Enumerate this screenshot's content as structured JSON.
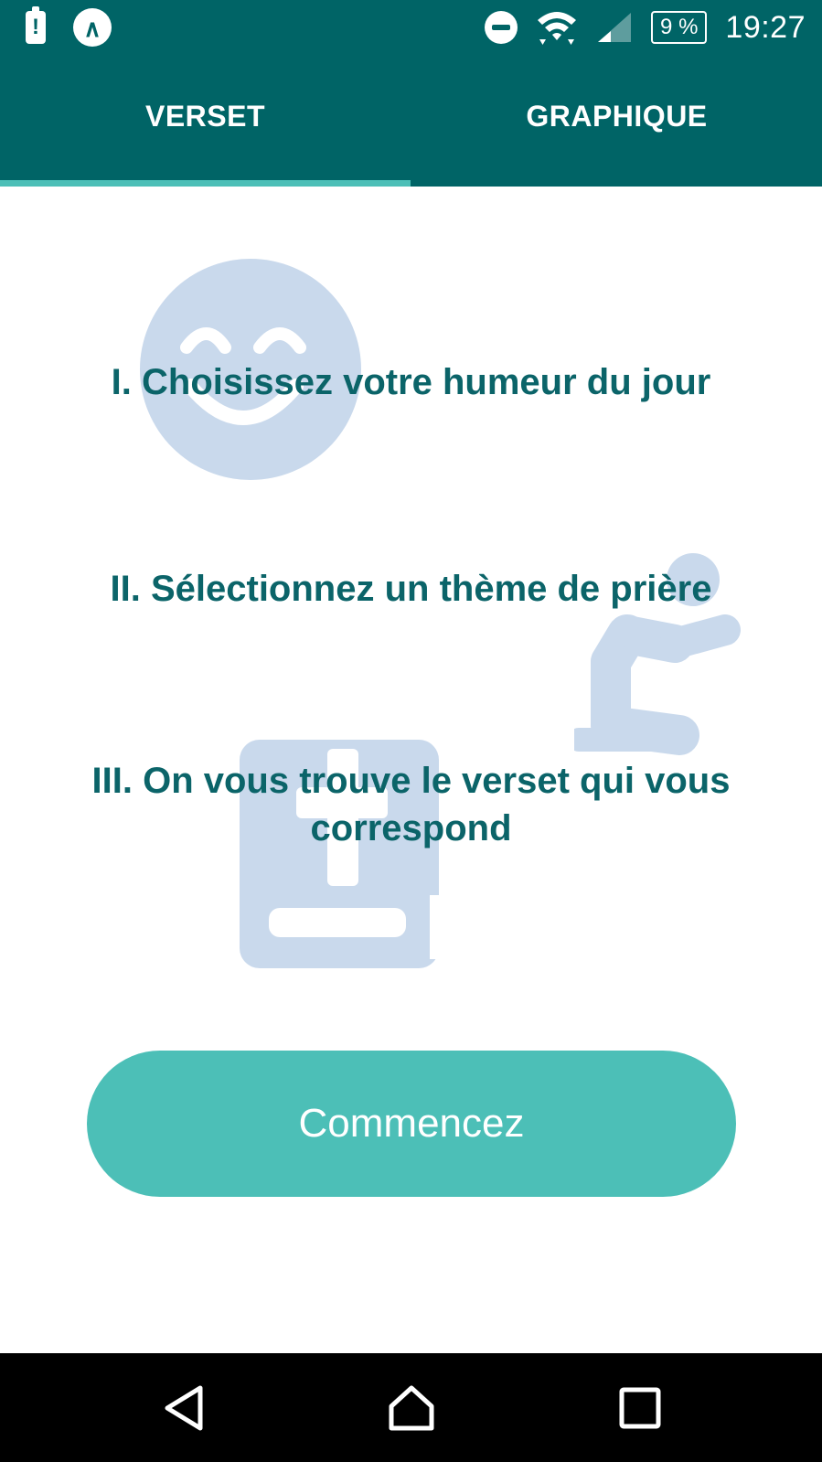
{
  "status_bar": {
    "time": "19:27",
    "battery": "9 %",
    "icons": [
      "battery-alert-icon",
      "app-notification-icon",
      "do-not-disturb-icon",
      "wifi-icon",
      "cell-signal-icon",
      "battery-icon"
    ],
    "app_icon_glyph": "∧",
    "alert_glyph": "!"
  },
  "tabs": [
    {
      "label": "VERSET",
      "selected": true
    },
    {
      "label": "GRAPHIQUE",
      "selected": false
    }
  ],
  "steps": [
    "I. Choisissez votre humeur du jour",
    "II. Sélectionnez un thème de prière",
    "III. On vous trouve le verset qui vous correspond"
  ],
  "decorations": [
    "smiley-face-icon",
    "praying-person-icon",
    "bible-icon"
  ],
  "start_button": {
    "label": "Commencez"
  },
  "nav": [
    "back-icon",
    "home-icon",
    "recent-apps-icon"
  ],
  "colors": {
    "primary": "#006466",
    "accent": "#4cbfb7",
    "step_text": "#0b6469",
    "decoration": "#c9d9ec"
  }
}
